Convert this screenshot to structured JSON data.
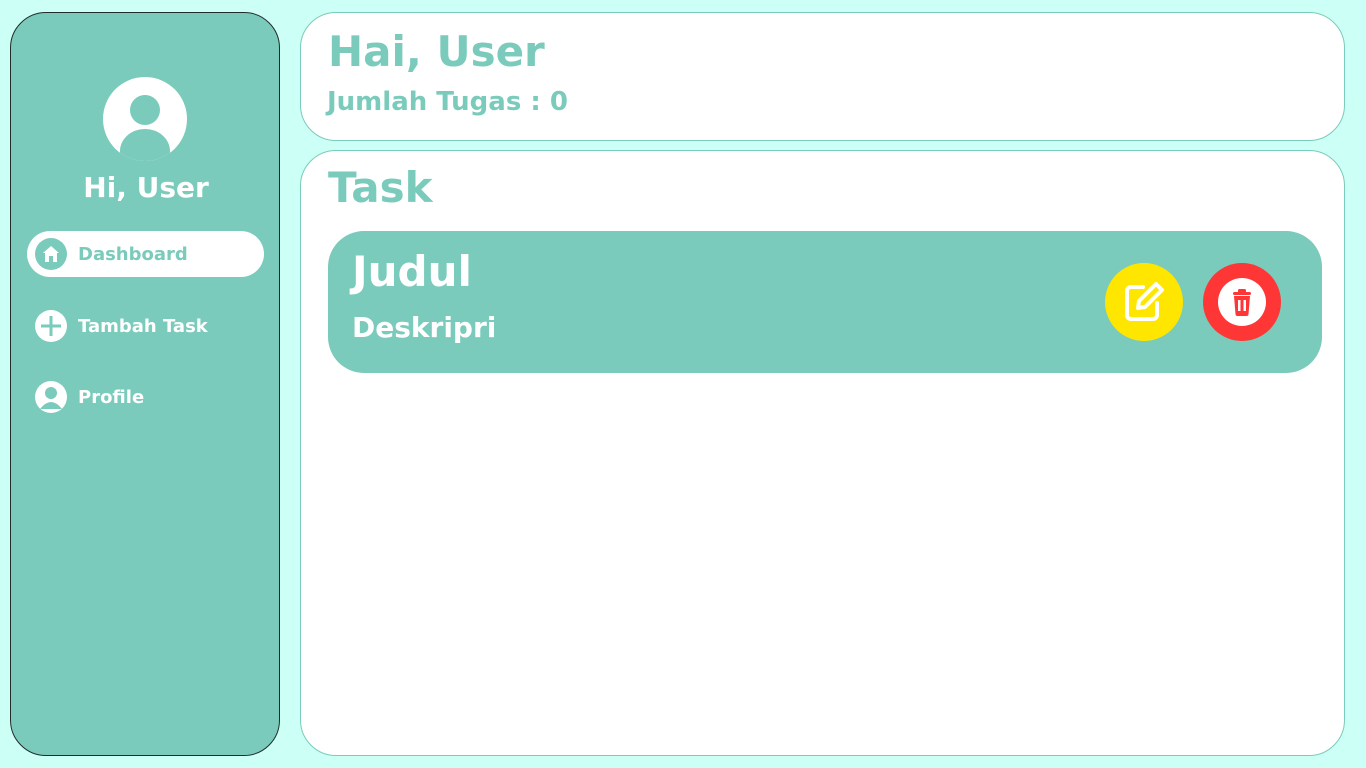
{
  "sidebar": {
    "greeting": "Hi, User",
    "items": [
      {
        "label": "Dashboard",
        "icon": "home-icon",
        "active": true
      },
      {
        "label": "Tambah Task",
        "icon": "plus-icon",
        "active": false
      },
      {
        "label": "Profile",
        "icon": "user-icon",
        "active": false
      }
    ]
  },
  "header": {
    "title": "Hai, User",
    "count_text": "Jumlah Tugas : 0"
  },
  "tasks": {
    "title": "Task",
    "items": [
      {
        "title": "Judul",
        "description": "Deskripri"
      }
    ]
  },
  "colors": {
    "page_bg": "#ccfff5",
    "accent": "#7acbbb",
    "edit_button": "#ffe600",
    "delete_button": "#ff3636"
  }
}
